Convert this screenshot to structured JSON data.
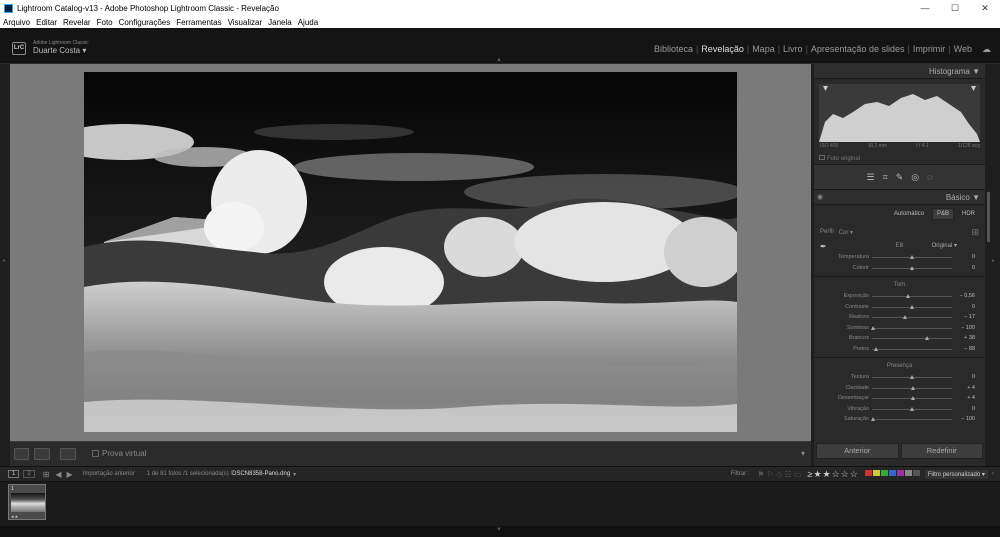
{
  "window": {
    "title": "Lightroom Catalog-v13 - Adobe Photoshop Lightroom Classic - Revelação"
  },
  "menu": [
    "Arquivo",
    "Editar",
    "Revelar",
    "Foto",
    "Configurações",
    "Ferramentas",
    "Visualizar",
    "Janela",
    "Ajuda"
  ],
  "identity": {
    "product": "Adobe Lightroom Classic",
    "user": "Duarte Costa",
    "logo": "LrC"
  },
  "modules": [
    "Biblioteca",
    "Revelação",
    "Mapa",
    "Livro",
    "Apresentação de slides",
    "Imprimir",
    "Web"
  ],
  "active_module": "Revelação",
  "toolbar": {
    "soft_proof": "Prova virtual"
  },
  "histogram": {
    "title": "Histograma",
    "iso": "ISO 400",
    "focal": "10,2 mm",
    "aperture": "f / 4,1",
    "shutter": "1/125 seg",
    "original": "Foto original"
  },
  "basic": {
    "title": "Básico",
    "treatments": [
      "Automático",
      "P&B",
      "HDR"
    ],
    "profile_label": "Perfil",
    "profile_value": "Cor",
    "wb_label": "EB",
    "wb_value": "Original",
    "tone_label": "Tom",
    "presence_label": "Presença",
    "wb_sliders": [
      {
        "label": "Temperatura",
        "value": "0",
        "pos": 0.5
      },
      {
        "label": "Colorir",
        "value": "0",
        "pos": 0.5
      }
    ],
    "tone_sliders": [
      {
        "label": "Exposição",
        "value": "− 0,56",
        "pos": 0.45
      },
      {
        "label": "Contraste",
        "value": "0",
        "pos": 0.5
      },
      {
        "label": "Realces",
        "value": "− 17",
        "pos": 0.42
      },
      {
        "label": "Sombras",
        "value": "− 100",
        "pos": 0.02
      },
      {
        "label": "Brancos",
        "value": "+ 38",
        "pos": 0.69
      },
      {
        "label": "Pretos",
        "value": "− 88",
        "pos": 0.06
      }
    ],
    "presence_sliders": [
      {
        "label": "Textura",
        "value": "0",
        "pos": 0.5
      },
      {
        "label": "Claridade",
        "value": "+ 4",
        "pos": 0.52
      },
      {
        "label": "Desembaçar",
        "value": "+ 4",
        "pos": 0.52
      },
      {
        "label": "Vibração",
        "value": "0",
        "pos": 0.5
      },
      {
        "label": "Saturação",
        "value": "− 100",
        "pos": 0.02
      }
    ]
  },
  "buttons": {
    "previous": "Anterior",
    "reset": "Redefinir"
  },
  "filmbar": {
    "source": "Importação anterior",
    "info": "1 de 81 fotos /1 selecionada(s) /",
    "filename": "DSCN8358-Pano.dng",
    "filter_label": "Filtrar :",
    "custom_filter": "Filtro personalizado"
  },
  "filmstrip": {
    "thumb_number": "1",
    "thumb_stars": "★★"
  },
  "colors": {
    "panel_bg": "#2a2a2a",
    "canvas_bg": "#7a7a7a",
    "active_module": "#dddddd"
  }
}
